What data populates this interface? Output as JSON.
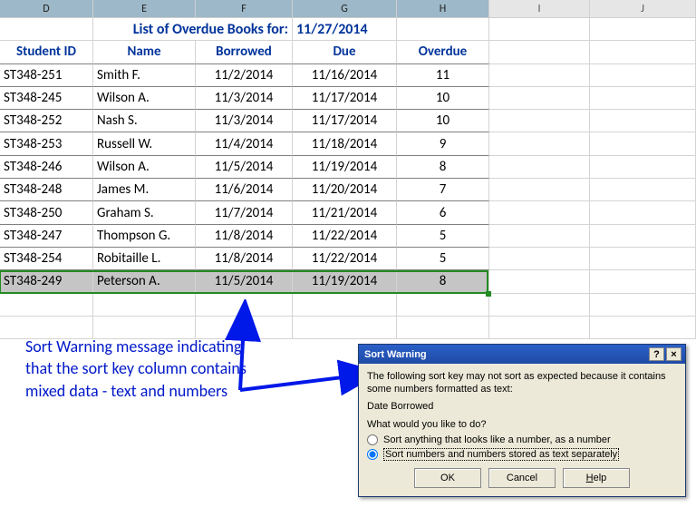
{
  "columns": [
    "D",
    "E",
    "F",
    "G",
    "H",
    "I",
    "J"
  ],
  "title": {
    "text": "List of Overdue Books for:",
    "date": "11/27/2014"
  },
  "headers": {
    "student_id": "Student ID",
    "name": "Name",
    "borrowed": "Borrowed",
    "due": "Due",
    "overdue": "Overdue"
  },
  "rows": [
    {
      "id": "ST348-251",
      "name": "Smith F.",
      "borrowed": "11/2/2014",
      "due": "11/16/2014",
      "overdue": "11"
    },
    {
      "id": "ST348-245",
      "name": "Wilson A.",
      "borrowed": "11/3/2014",
      "due": "11/17/2014",
      "overdue": "10"
    },
    {
      "id": "ST348-252",
      "name": "Nash S.",
      "borrowed": "11/3/2014",
      "due": "11/17/2014",
      "overdue": "10"
    },
    {
      "id": "ST348-253",
      "name": "Russell W.",
      "borrowed": "11/4/2014",
      "due": "11/18/2014",
      "overdue": "9"
    },
    {
      "id": "ST348-246",
      "name": "Wilson A.",
      "borrowed": "11/5/2014",
      "due": "11/19/2014",
      "overdue": "8"
    },
    {
      "id": "ST348-248",
      "name": "James M.",
      "borrowed": "11/6/2014",
      "due": "11/20/2014",
      "overdue": "7"
    },
    {
      "id": "ST348-250",
      "name": "Graham S.",
      "borrowed": "11/7/2014",
      "due": "11/21/2014",
      "overdue": "6"
    },
    {
      "id": "ST348-247",
      "name": "Thompson G.",
      "borrowed": "11/8/2014",
      "due": "11/22/2014",
      "overdue": "5"
    },
    {
      "id": "ST348-254",
      "name": "Robitaille L.",
      "borrowed": "11/8/2014",
      "due": "11/22/2014",
      "overdue": "5"
    },
    {
      "id": "ST348-249",
      "name": "Peterson A.",
      "borrowed": "11/5/2014",
      "due": "11/19/2014",
      "overdue": "8"
    }
  ],
  "annotation": "Sort Warning message indicating that the sort key column contains mixed data - text and numbers",
  "dialog": {
    "title": "Sort Warning",
    "help_icon": "?",
    "close_icon": "×",
    "line1": "The following sort key may not sort as expected because it contains some numbers formatted as text:",
    "sort_key": "Date Borrowed",
    "prompt": "What would you like to do?",
    "option1": "Sort anything that looks like a number, as a number",
    "option2": "Sort numbers and numbers stored as text separately",
    "ok": "OK",
    "cancel": "Cancel",
    "help": "Help"
  }
}
